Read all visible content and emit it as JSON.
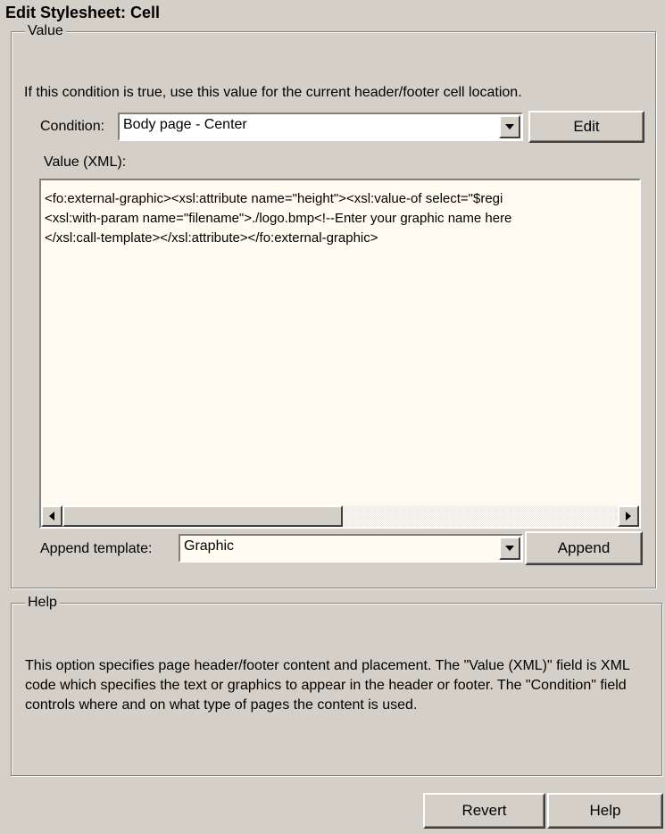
{
  "window": {
    "title": "Edit Stylesheet: Cell"
  },
  "value_group": {
    "legend": "Value",
    "instruction": "If this condition is true, use this value for the current header/footer cell location.",
    "condition_label": "Condition:",
    "condition_value": "Body page - Center",
    "edit_button": "Edit",
    "value_label": "Value (XML):",
    "xml_lines": [
      "<fo:external-graphic><xsl:attribute name=\"height\"><xsl:value-of select=\"$regi",
      "<xsl:with-param name=\"filename\">./logo.bmp<!--Enter your graphic name here",
      "</xsl:call-template></xsl:attribute></fo:external-graphic>"
    ],
    "append_label": "Append template:",
    "append_value": "Graphic",
    "append_button": "Append"
  },
  "help_group": {
    "legend": "Help",
    "text": "This option specifies page header/footer content and placement.  The \"Value (XML)\" field is XML code which specifies the text or graphics to appear in the header or footer.  The \"Condition\" field controls where and on what type of pages the content is used."
  },
  "footer": {
    "revert_button": "Revert",
    "help_button": "Help"
  },
  "colors": {
    "dialog_bg": "#d4d0c8",
    "editor_bg": "#fffbf0",
    "combo_bg": "#ffffff"
  },
  "icons": {
    "combo_arrow": "chevron-down-icon",
    "scroll_left": "arrow-left-icon",
    "scroll_right": "arrow-right-icon"
  }
}
